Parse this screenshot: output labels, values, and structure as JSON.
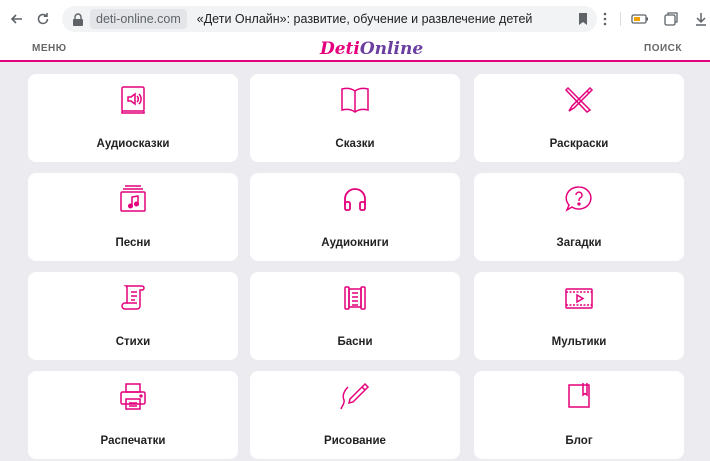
{
  "browser": {
    "domain": "deti-online.com",
    "page_title": "«Дети Онлайн»: развитие, обучение и развлечение детей"
  },
  "site": {
    "menu_label": "МЕНЮ",
    "search_label": "ПОИСК",
    "logo_part1": "Deti",
    "logo_part2": "Online"
  },
  "accent_color": "#e4007c",
  "categories": [
    {
      "label": "Аудиосказки",
      "icon": "speaker-book-icon"
    },
    {
      "label": "Сказки",
      "icon": "open-book-icon"
    },
    {
      "label": "Раскраски",
      "icon": "pencil-brush-icon"
    },
    {
      "label": "Песни",
      "icon": "music-note-icon"
    },
    {
      "label": "Аудиокниги",
      "icon": "headphones-icon"
    },
    {
      "label": "Загадки",
      "icon": "question-bubble-icon"
    },
    {
      "label": "Стихи",
      "icon": "scroll-poem-icon"
    },
    {
      "label": "Басни",
      "icon": "scroll-fable-icon"
    },
    {
      "label": "Мультики",
      "icon": "film-play-icon"
    },
    {
      "label": "Распечатки",
      "icon": "printer-icon"
    },
    {
      "label": "Рисование",
      "icon": "pen-drawing-icon"
    },
    {
      "label": "Блог",
      "icon": "notebook-icon"
    }
  ]
}
